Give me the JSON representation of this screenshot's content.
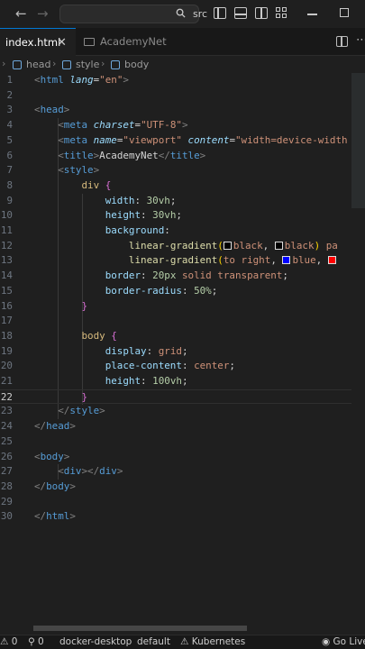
{
  "titlebar": {
    "search_text": "src",
    "nav_back": "←",
    "nav_forward": "→"
  },
  "tabs": [
    {
      "label": "index.html",
      "active": true,
      "close": "✕"
    },
    {
      "label": "AcademyNet",
      "active": false
    }
  ],
  "breadcrumb": [
    "head",
    "style",
    "body"
  ],
  "editor": {
    "lines": [
      {
        "n": "1",
        "html": "<span class='t-br'>&lt;</span><span class='t-tag'>html</span> <span class='t-attri'>lang</span><span class='t-pun'>=</span><span class='t-str'>\"en\"</span><span class='t-br'>&gt;</span>"
      },
      {
        "n": "2",
        "html": ""
      },
      {
        "n": "3",
        "html": "<span class='t-br'>&lt;</span><span class='t-tag'>head</span><span class='t-br'>&gt;</span>"
      },
      {
        "n": "4",
        "html": "    <span class='t-br'>&lt;</span><span class='t-tag'>meta</span> <span class='t-attri'>charset</span><span class='t-pun'>=</span><span class='t-str'>\"UTF-8\"</span><span class='t-br'>&gt;</span>"
      },
      {
        "n": "5",
        "html": "    <span class='t-br'>&lt;</span><span class='t-tag'>meta</span> <span class='t-attri'>name</span><span class='t-pun'>=</span><span class='t-str'>\"viewport\"</span> <span class='t-attri'>content</span><span class='t-pun'>=</span><span class='t-str'>\"width=device-width</span>"
      },
      {
        "n": "6",
        "html": "    <span class='t-br'>&lt;</span><span class='t-tag'>title</span><span class='t-br'>&gt;</span><span class='t-txt'>AcademyNet</span><span class='t-br'>&lt;/</span><span class='t-tag'>title</span><span class='t-br'>&gt;</span>"
      },
      {
        "n": "7",
        "html": "    <span class='t-br'>&lt;</span><span class='t-tag'>style</span><span class='t-br'>&gt;</span>"
      },
      {
        "n": "8",
        "html": "        <span class='t-sel'>div</span> <span class='t-brace'>{</span>"
      },
      {
        "n": "9",
        "html": "            <span class='t-prop'>width</span><span class='t-pun'>: </span><span class='t-num'>30vh</span><span class='t-pun'>;</span>"
      },
      {
        "n": "10",
        "html": "            <span class='t-prop'>height</span><span class='t-pun'>: </span><span class='t-num'>30vh</span><span class='t-pun'>;</span>"
      },
      {
        "n": "11",
        "html": "            <span class='t-prop'>background</span><span class='t-pun'>:</span>"
      },
      {
        "n": "12",
        "html": "                <span class='t-fn'>linear-gradient</span><span class='t-brace2'>(</span><span class='sw' style='background:#000'></span><span class='t-val'>black</span><span class='t-pun'>, </span><span class='sw' style='background:#000'></span><span class='t-val'>black</span><span class='t-brace2'>)</span> <span class='t-val'>pa</span>"
      },
      {
        "n": "13",
        "html": "                <span class='t-fn'>linear-gradient</span><span class='t-brace2'>(</span><span class='t-val'>to right</span><span class='t-pun'>, </span><span class='sw' style='background:#00f'></span><span class='t-val'>blue</span><span class='t-pun'>, </span><span class='sw' style='background:#f00'></span>"
      },
      {
        "n": "14",
        "html": "            <span class='t-prop'>border</span><span class='t-pun'>: </span><span class='t-num'>20px</span> <span class='t-val'>solid transparent</span><span class='t-pun'>;</span>"
      },
      {
        "n": "15",
        "html": "            <span class='t-prop'>border-radius</span><span class='t-pun'>: </span><span class='t-num'>50%</span><span class='t-pun'>;</span>"
      },
      {
        "n": "16",
        "html": "        <span class='t-brace'>}</span>"
      },
      {
        "n": "17",
        "html": ""
      },
      {
        "n": "18",
        "html": "        <span class='t-sel'>body</span> <span class='t-brace'>{</span>"
      },
      {
        "n": "19",
        "html": "            <span class='t-prop'>display</span><span class='t-pun'>: </span><span class='t-val'>grid</span><span class='t-pun'>;</span>"
      },
      {
        "n": "20",
        "html": "            <span class='t-prop'>place-content</span><span class='t-pun'>: </span><span class='t-val'>center</span><span class='t-pun'>;</span>"
      },
      {
        "n": "21",
        "html": "            <span class='t-prop'>height</span><span class='t-pun'>: </span><span class='t-num'>100vh</span><span class='t-pun'>;</span>"
      },
      {
        "n": "22",
        "html": "        <span class='t-brace'>}</span>"
      },
      {
        "n": "23",
        "html": "    <span class='t-br'>&lt;/</span><span class='t-tag'>style</span><span class='t-br'>&gt;</span>"
      },
      {
        "n": "24",
        "html": "<span class='t-br'>&lt;/</span><span class='t-tag'>head</span><span class='t-br'>&gt;</span>"
      },
      {
        "n": "25",
        "html": ""
      },
      {
        "n": "26",
        "html": "<span class='t-br'>&lt;</span><span class='t-tag'>body</span><span class='t-br'>&gt;</span>"
      },
      {
        "n": "27",
        "html": "    <span class='t-br'>&lt;</span><span class='t-tag'>div</span><span class='t-br'>&gt;&lt;/</span><span class='t-tag'>div</span><span class='t-br'>&gt;</span>"
      },
      {
        "n": "28",
        "html": "<span class='t-br'>&lt;/</span><span class='t-tag'>body</span><span class='t-br'>&gt;</span>"
      },
      {
        "n": "29",
        "html": ""
      },
      {
        "n": "30",
        "html": "<span class='t-br'>&lt;/</span><span class='t-tag'>html</span><span class='t-br'>&gt;</span>"
      }
    ],
    "current_line": "22"
  },
  "statusbar": {
    "errors": "0",
    "ports": "0",
    "context": "docker-desktop",
    "namespace": "default",
    "kubernetes": "Kubernetes",
    "golive": "Go Live"
  },
  "colors": {
    "accent": "#0078d4",
    "background": "#1f1f1f"
  }
}
